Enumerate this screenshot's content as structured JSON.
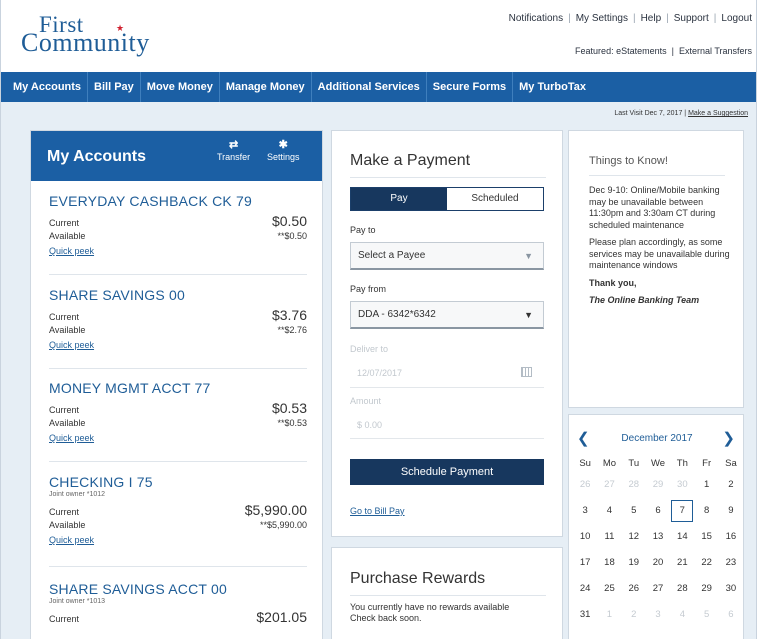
{
  "brand": {
    "logo_line1": "First",
    "logo_line2": "Community",
    "accent": "#1b5fa4",
    "dark": "#17375e",
    "star_color": "#d0202f"
  },
  "utility_links": [
    "Notifications",
    "My Settings",
    "Help",
    "Support",
    "Logout"
  ],
  "featured": {
    "label": "Featured:",
    "links": [
      "eStatements",
      "External Transfers"
    ]
  },
  "nav": [
    "My Accounts",
    "Bill Pay",
    "Move Money",
    "Manage Money",
    "Additional Services",
    "Secure Forms",
    "My TurboTax"
  ],
  "last_visit": {
    "text": "Last Visit Dec 7, 2017",
    "link": "Make a Suggestion"
  },
  "accounts_panel": {
    "title": "My Accounts",
    "transfer_label": "Transfer",
    "settings_label": "Settings",
    "current_label": "Current",
    "available_label": "Available",
    "quick_peek_label": "Quick peek",
    "accounts": [
      {
        "name": "EVERYDAY CASHBACK CK 79",
        "sub": "",
        "current": "$0.50",
        "available": "**$0.50"
      },
      {
        "name": "SHARE SAVINGS 00",
        "sub": "",
        "current": "$3.76",
        "available": "**$2.76"
      },
      {
        "name": "MONEY MGMT ACCT 77",
        "sub": "",
        "current": "$0.53",
        "available": "**$0.53"
      },
      {
        "name": "CHECKING I 75",
        "sub": "Joint owner *1012",
        "current": "$5,990.00",
        "available": "**$5,990.00"
      },
      {
        "name": "SHARE SAVINGS ACCT 00",
        "sub": "Joint owner *1013",
        "current": "$201.05",
        "available": ""
      }
    ]
  },
  "payment": {
    "title": "Make a Payment",
    "tab_pay": "Pay",
    "tab_scheduled": "Scheduled",
    "pay_to_label": "Pay to",
    "pay_to_value": "Select a Payee",
    "pay_from_label": "Pay from",
    "pay_from_value": "DDA - 6342*6342",
    "deliver_label": "Deliver to",
    "deliver_value": "12/07/2017",
    "amount_label": "Amount",
    "amount_value": "$ 0.00",
    "schedule_button": "Schedule Payment",
    "go_to_bill_pay": "Go to Bill Pay"
  },
  "rewards": {
    "title": "Purchase Rewards",
    "line1": "You currently have no rewards available",
    "line2": "Check back soon."
  },
  "things_to_know": {
    "title": "Things to Know!",
    "p1": "Dec 9-10:  Online/Mobile banking may be unavailable between 11:30pm and 3:30am CT during scheduled maintenance",
    "p2": "Please plan accordingly, as some services may be unavailable during maintenance windows",
    "p3": "Thank you,",
    "p4": "The Online Banking Team"
  },
  "calendar": {
    "month": "December 2017",
    "prev": "<",
    "next": ">",
    "weekdays": [
      "Su",
      "Mo",
      "Tu",
      "We",
      "Th",
      "Fr",
      "Sa"
    ],
    "today": "7",
    "days": [
      {
        "d": "26",
        "o": true
      },
      {
        "d": "27",
        "o": true
      },
      {
        "d": "28",
        "o": true
      },
      {
        "d": "29",
        "o": true
      },
      {
        "d": "30",
        "o": true
      },
      {
        "d": "1",
        "o": false
      },
      {
        "d": "2",
        "o": false
      },
      {
        "d": "3",
        "o": false
      },
      {
        "d": "4",
        "o": false
      },
      {
        "d": "5",
        "o": false
      },
      {
        "d": "6",
        "o": false
      },
      {
        "d": "7",
        "o": false
      },
      {
        "d": "8",
        "o": false
      },
      {
        "d": "9",
        "o": false
      },
      {
        "d": "10",
        "o": false
      },
      {
        "d": "11",
        "o": false
      },
      {
        "d": "12",
        "o": false
      },
      {
        "d": "13",
        "o": false
      },
      {
        "d": "14",
        "o": false
      },
      {
        "d": "15",
        "o": false
      },
      {
        "d": "16",
        "o": false
      },
      {
        "d": "17",
        "o": false
      },
      {
        "d": "18",
        "o": false
      },
      {
        "d": "19",
        "o": false
      },
      {
        "d": "20",
        "o": false
      },
      {
        "d": "21",
        "o": false
      },
      {
        "d": "22",
        "o": false
      },
      {
        "d": "23",
        "o": false
      },
      {
        "d": "24",
        "o": false
      },
      {
        "d": "25",
        "o": false
      },
      {
        "d": "26",
        "o": false
      },
      {
        "d": "27",
        "o": false
      },
      {
        "d": "28",
        "o": false
      },
      {
        "d": "29",
        "o": false
      },
      {
        "d": "30",
        "o": false
      },
      {
        "d": "31",
        "o": false
      },
      {
        "d": "1",
        "o": true
      },
      {
        "d": "2",
        "o": true
      },
      {
        "d": "3",
        "o": true
      },
      {
        "d": "4",
        "o": true
      },
      {
        "d": "5",
        "o": true
      },
      {
        "d": "6",
        "o": true
      }
    ]
  }
}
